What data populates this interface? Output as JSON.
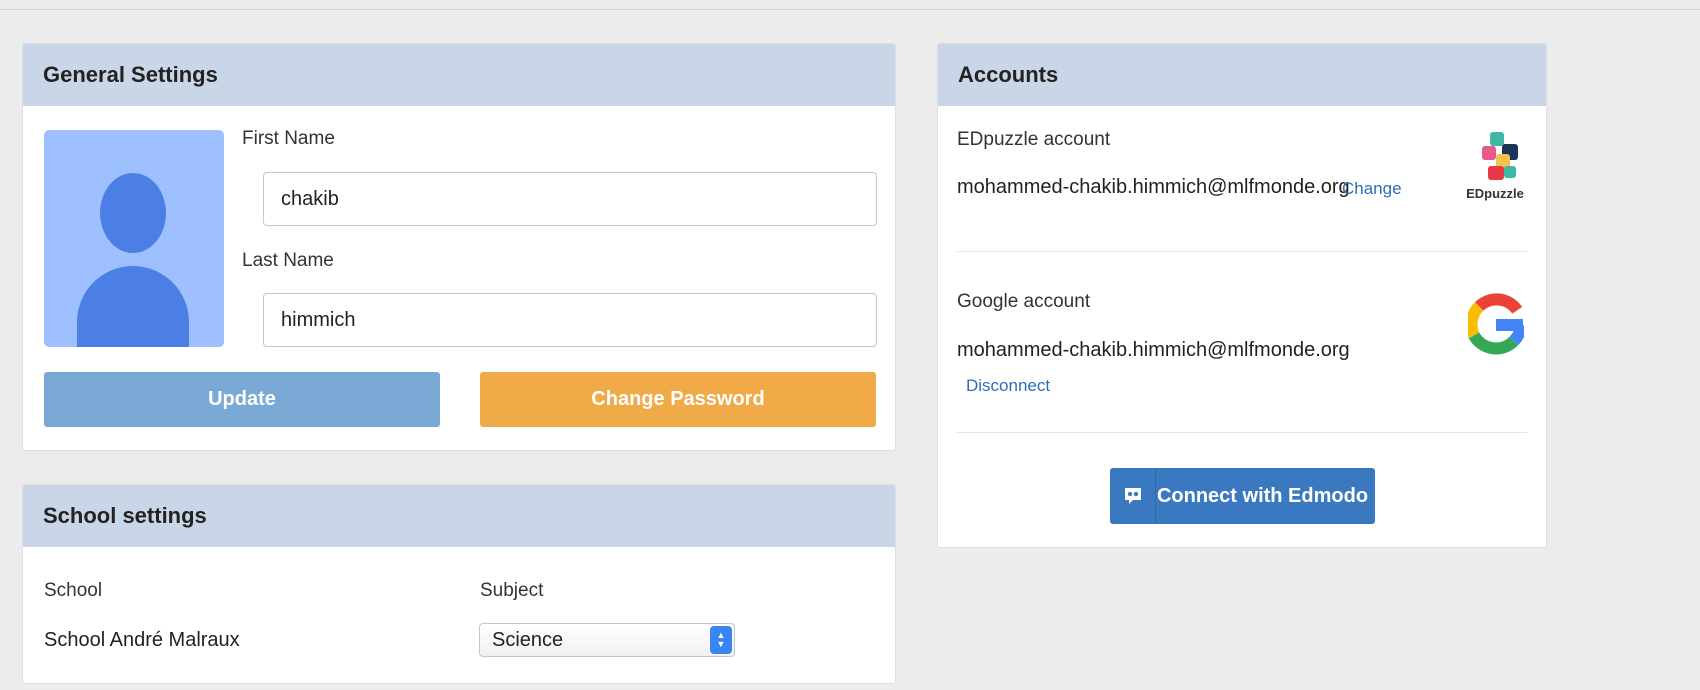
{
  "general": {
    "title": "General Settings",
    "first_name_label": "First Name",
    "first_name_value": "chakib",
    "last_name_label": "Last Name",
    "last_name_value": "himmich",
    "update_label": "Update",
    "change_password_label": "Change Password"
  },
  "school": {
    "title": "School settings",
    "school_label": "School",
    "school_value": "School André Malraux",
    "subject_label": "Subject",
    "subject_value": "Science"
  },
  "accounts": {
    "title": "Accounts",
    "edpuzzle": {
      "label": "EDpuzzle account",
      "email": "mohammed-chakib.himmich@mlfmonde.org",
      "change_link": "Change",
      "logo_text": "EDpuzzle"
    },
    "google": {
      "label": "Google account",
      "email": "mohammed-chakib.himmich@mlfmonde.org",
      "disconnect_link": "Disconnect"
    },
    "edmodo_button": "Connect with Edmodo"
  },
  "colors": {
    "panel_header": "#c9d6e8",
    "update_button": "#7aa9d5",
    "change_password_button": "#f0aa48",
    "edmodo_button": "#3a78bf",
    "link": "#2d6fb6"
  },
  "icons": [
    "user-avatar-icon",
    "edpuzzle-logo",
    "google-logo",
    "edmodo-icon",
    "select-arrows-icon"
  ]
}
